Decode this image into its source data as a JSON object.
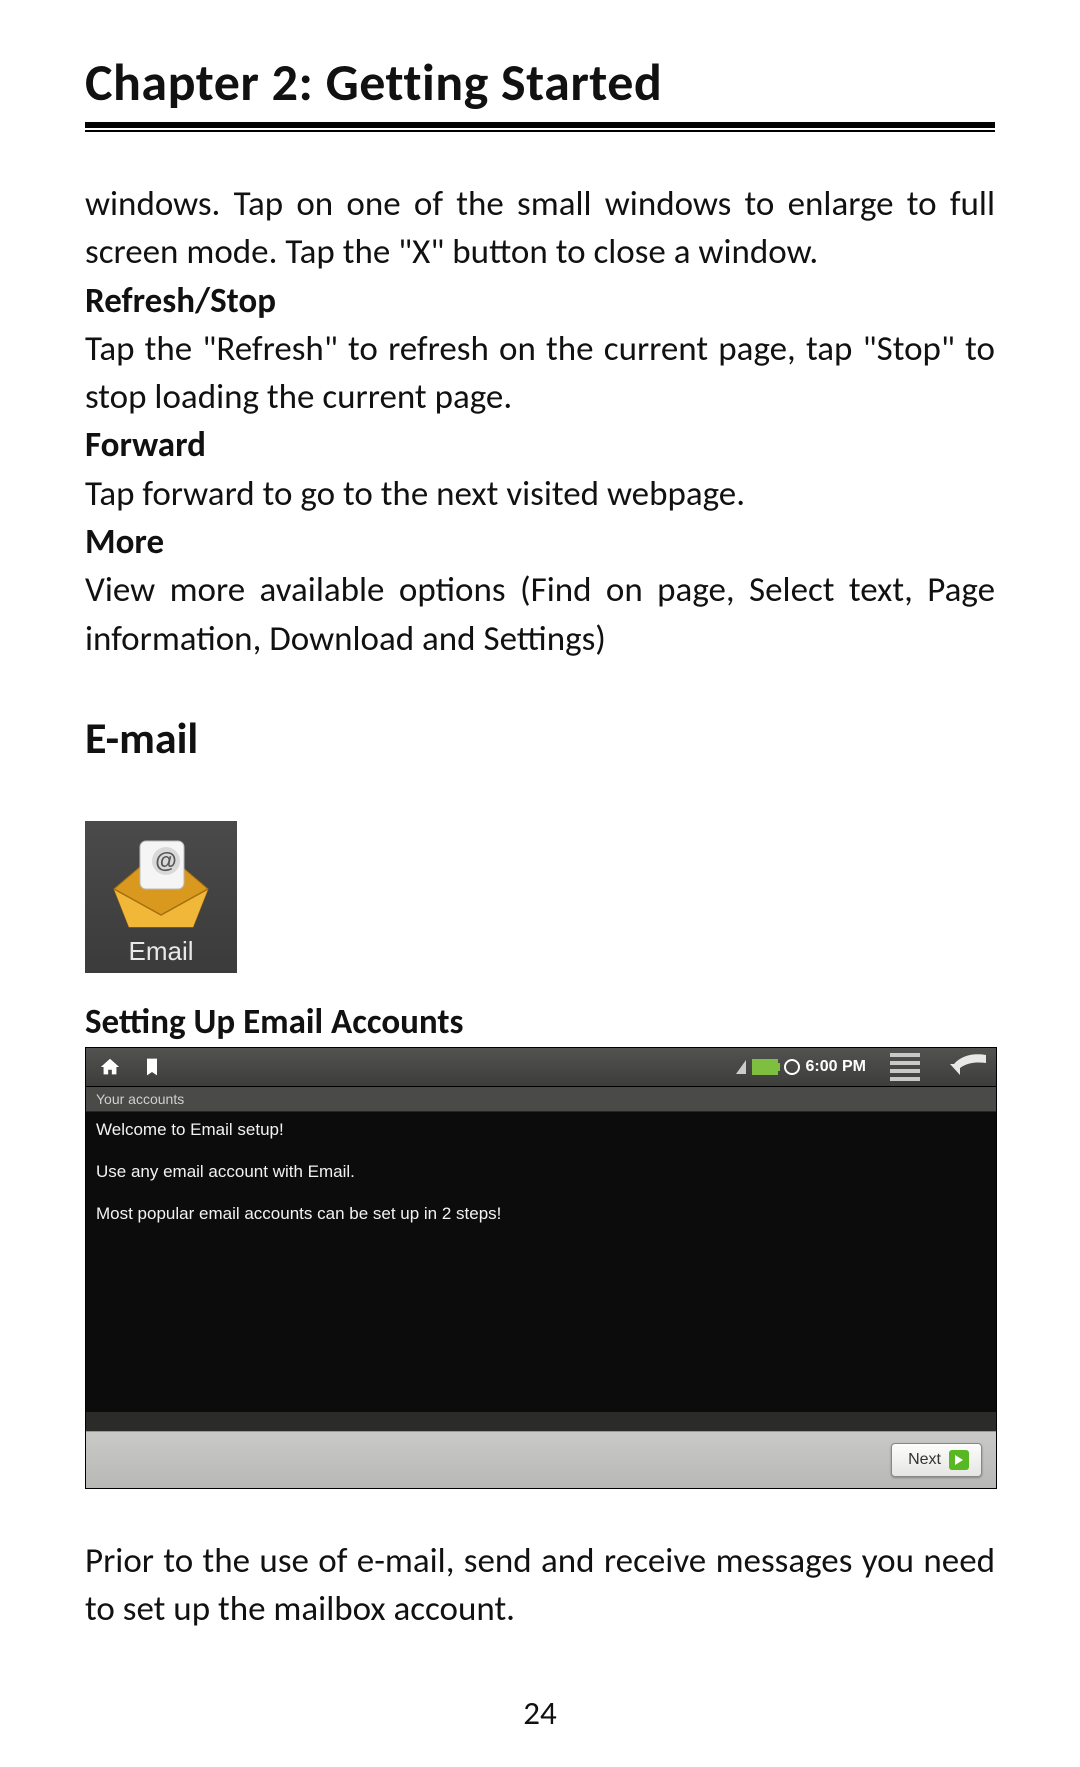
{
  "chapter": {
    "title": "Chapter 2: Getting Started"
  },
  "continuation_text": "windows. Tap on one of the small windows to enlarge to full screen mode.    Tap the \"X\" button to close a window.",
  "sections": {
    "refresh": {
      "heading": "Refresh/Stop",
      "body": "Tap the \"Refresh\" to refresh on the current page, tap \"Stop\" to stop loading the current page."
    },
    "forward": {
      "heading": "Forward",
      "body": "Tap forward to go to the next visited webpage."
    },
    "more": {
      "heading": "More",
      "body": "View more available options (Find on page, Select text, Page information, Download and Settings)"
    }
  },
  "email_section": {
    "heading": "E-mail",
    "icon_label": "Email",
    "sub_heading": "Setting Up Email Accounts",
    "intro_after_shot": "Prior to the use of e-mail, send and receive messages you need to set up the mailbox account."
  },
  "android_shot": {
    "subheader": "Your accounts",
    "line1": "Welcome to Email setup!",
    "line2": "Use any email account with Email.",
    "line3": "Most popular email accounts can be set up in 2 steps!",
    "clock": "6:00 PM",
    "next_label": "Next"
  },
  "page_number": "24"
}
